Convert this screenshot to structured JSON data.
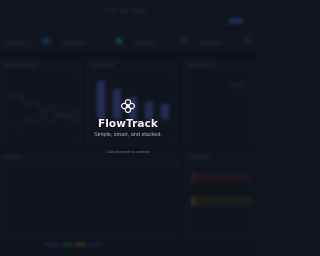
{
  "splash": {
    "app_name": "FlowTrack",
    "tagline": "Simple, smart, and stacked.",
    "hint": "Click anywhere to continue",
    "logo_icon": "flower-logo-icon"
  },
  "colors": {
    "background": "#12161f",
    "accent": "#4d5fc6",
    "primary_button": "#3562c9",
    "title_text": "#f2f4f8",
    "tagline_text": "#a9b0c0",
    "hint_text": "#6b7386"
  },
  "background_dashboard": {
    "blurred": true,
    "bar_chart_relative_levels": [
      1.0,
      0.75,
      0.55,
      0.42,
      0.38
    ]
  }
}
